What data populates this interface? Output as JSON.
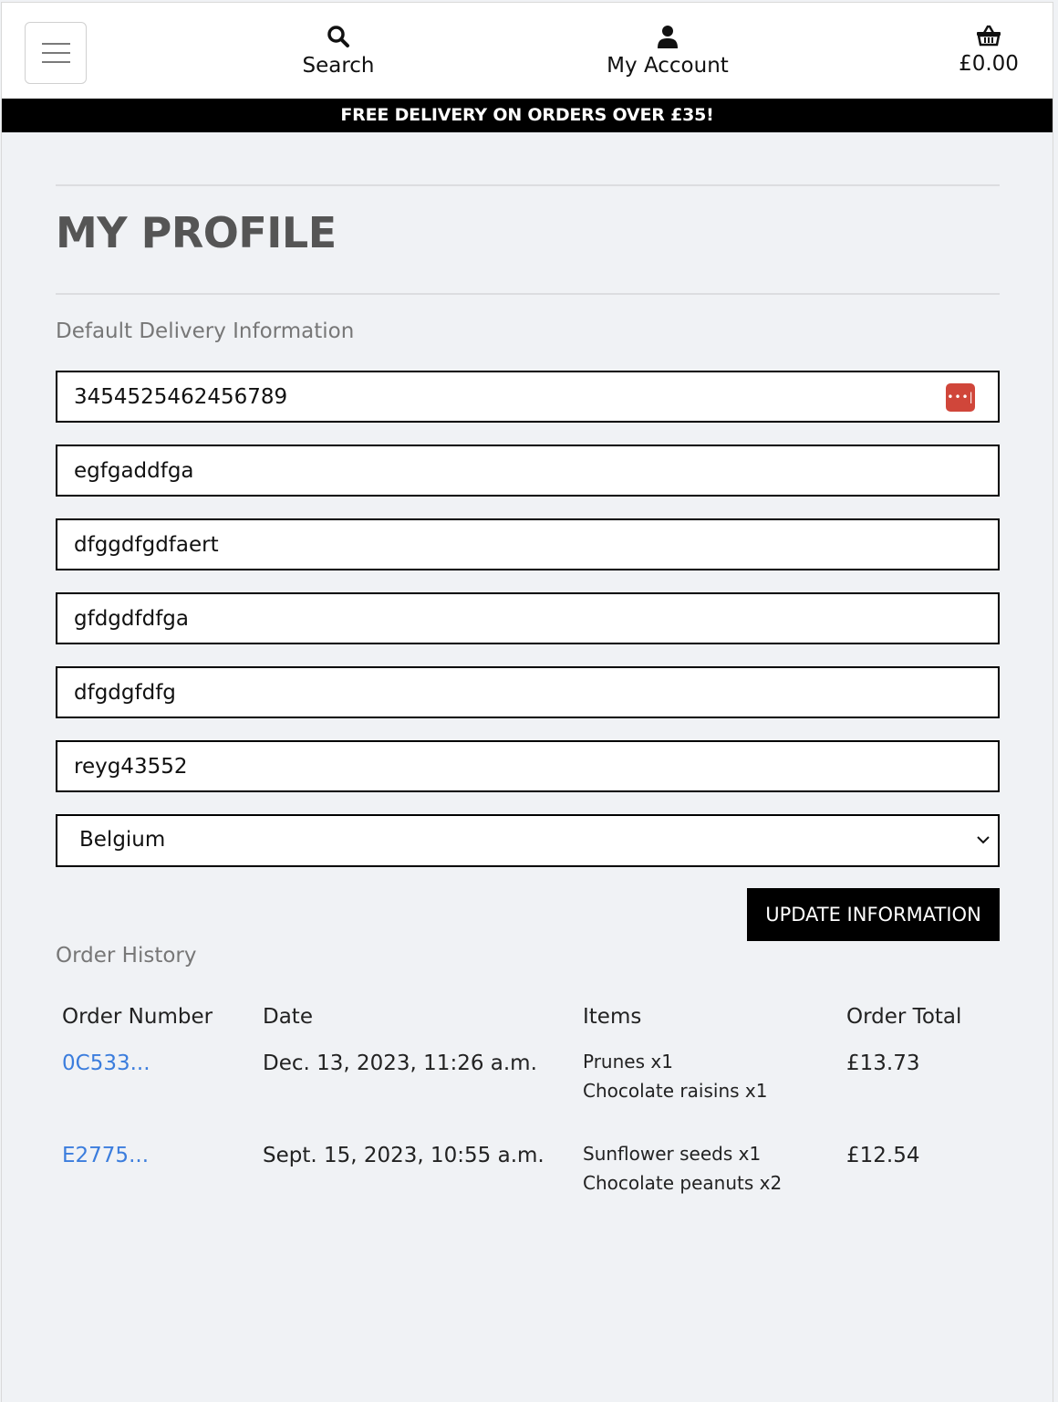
{
  "header": {
    "search_label": "Search",
    "account_label": "My Account",
    "bag_total": "£0.00"
  },
  "banner": {
    "text": "FREE DELIVERY ON ORDERS OVER £35!"
  },
  "profile": {
    "title": "MY PROFILE",
    "delivery_heading": "Default Delivery Information",
    "fields": [
      "3454525462456789",
      "egfgaddfga",
      "dfggdfgdfaert",
      "gfdgdfdfga",
      "dfgdgfdfg",
      "reyg43552"
    ],
    "country": "Belgium",
    "update_label": "UPDATE INFORMATION"
  },
  "orders": {
    "heading": "Order History",
    "columns": [
      "Order Number",
      "Date",
      "Items",
      "Order Total"
    ],
    "rows": [
      {
        "number": "0C533...",
        "date": "Dec. 13, 2023, 11:26 a.m.",
        "items": [
          "Prunes x1",
          "Chocolate raisins x1"
        ],
        "total": "£13.73"
      },
      {
        "number": "E2775...",
        "date": "Sept. 15, 2023, 10:55 a.m.",
        "items": [
          "Sunflower seeds x1",
          "Chocolate peanuts x2"
        ],
        "total": "£12.54"
      }
    ]
  },
  "icons": {
    "search": "search-icon",
    "account": "user-icon",
    "bag": "shopping-basket-icon",
    "menu": "hamburger-menu-icon",
    "password": "password-manager-icon",
    "caret": "chevron-down-icon"
  },
  "colors": {
    "banner_bg": "#000000",
    "link": "#3b7ddd",
    "button_bg": "#000000",
    "page_bg": "#f0f2f5"
  }
}
